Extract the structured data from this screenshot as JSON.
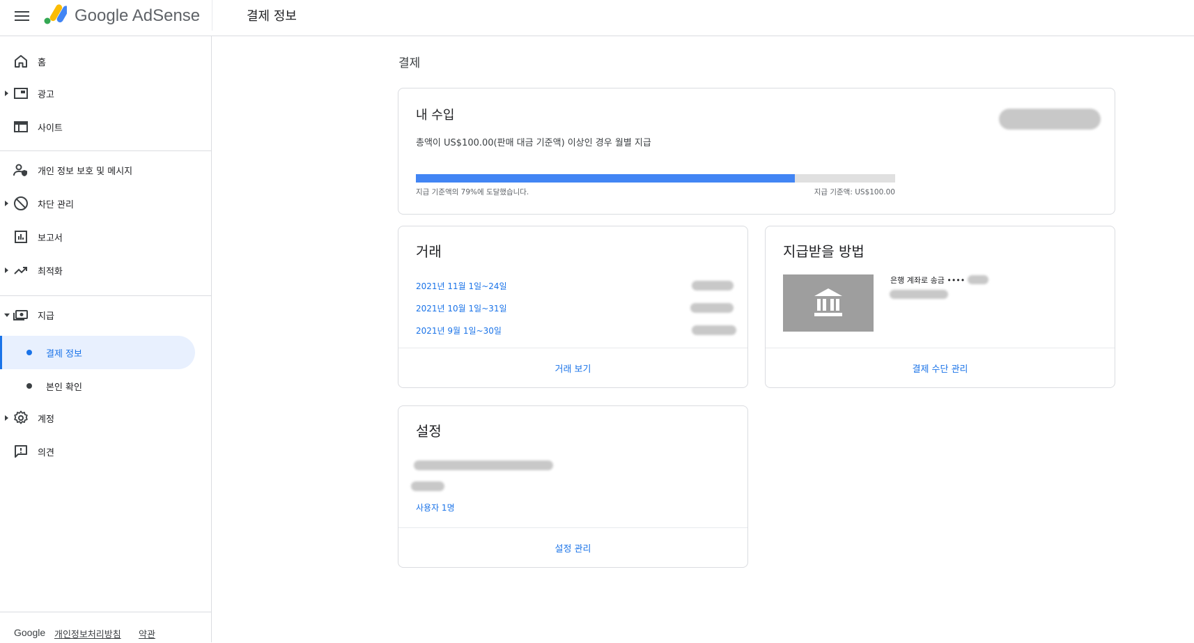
{
  "header": {
    "brand": "Google AdSense",
    "page_title": "결제 정보"
  },
  "sidebar": {
    "items": [
      {
        "label": "홈"
      },
      {
        "label": "광고"
      },
      {
        "label": "사이트"
      },
      {
        "label": "개인 정보 보호 및 메시지"
      },
      {
        "label": "차단 관리"
      },
      {
        "label": "보고서"
      },
      {
        "label": "최적화"
      },
      {
        "label": "지급"
      },
      {
        "label": "결제 정보"
      },
      {
        "label": "본인 확인"
      },
      {
        "label": "계정"
      },
      {
        "label": "의견"
      }
    ],
    "footer": {
      "google": "Google",
      "privacy": "개인정보처리방침",
      "terms": "약관"
    }
  },
  "main": {
    "title": "결제",
    "earnings": {
      "title": "내 수입",
      "description": "총액이 US$100.00(판매 대금 기준액) 이상인 경우 월별 지급",
      "progress_percent": 79,
      "progress_text": "지급 기준액의 79%에 도달했습니다.",
      "threshold_text": "지급 기준액: US$100.00"
    },
    "transactions": {
      "title": "거래",
      "rows": [
        "2021년 11월 1일~24일",
        "2021년 10월 1일~31일",
        "2021년 9월 1일~30일"
      ],
      "footer_link": "거래 보기"
    },
    "payment_method": {
      "title": "지급받을 방법",
      "method_label": "은행 계좌로 송금 ••••",
      "footer_link": "결제 수단 관리"
    },
    "settings": {
      "title": "설정",
      "users_link": "사용자 1명",
      "footer_link": "설정 관리"
    }
  },
  "colors": {
    "accent": "#1a73e8",
    "progress": "#4285f4",
    "active_bg": "#e8f0fe"
  }
}
